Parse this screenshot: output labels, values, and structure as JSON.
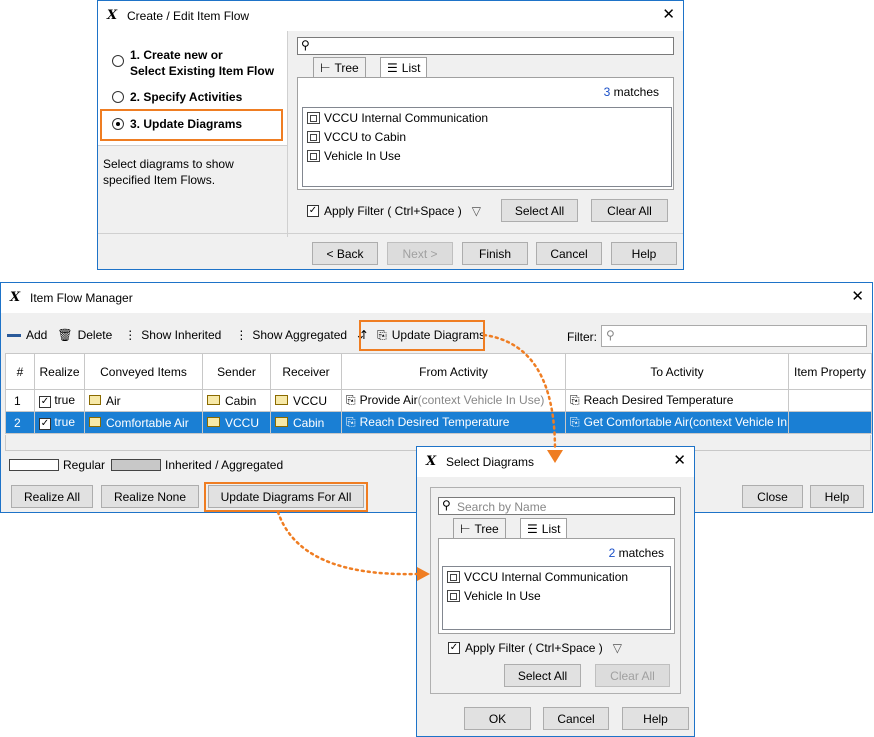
{
  "create_dialog": {
    "title": "Create / Edit Item Flow",
    "steps": [
      {
        "line1": "1. Create new or",
        "line2": "Select Existing Item Flow"
      },
      {
        "line1": "2. Specify Activities"
      },
      {
        "line1": "3. Update Diagrams"
      }
    ],
    "description_l1": "Select diagrams to show",
    "description_l2": "specified Item Flows.",
    "tabs": [
      "Tree",
      "List"
    ],
    "match_count": "3",
    "match_label": "matches",
    "items": [
      "VCCU Internal Communication",
      "VCCU to Cabin",
      "Vehicle In Use"
    ],
    "apply_filter": "Apply Filter ( Ctrl+Space )",
    "select_all": "Select All",
    "clear_all": "Clear All",
    "back": "< Back",
    "next": "Next >",
    "finish": "Finish",
    "cancel": "Cancel",
    "help": "Help"
  },
  "manager": {
    "title": "Item Flow Manager",
    "toolbar": {
      "add": "Add",
      "delete": "Delete",
      "show_inherited": "Show Inherited",
      "show_aggregated": "Show Aggregated",
      "update_diagrams": "Update Diagrams",
      "filter": "Filter:"
    },
    "columns": [
      "#",
      "Realize",
      "Conveyed Items",
      "Sender",
      "Receiver",
      "From Activity",
      "To Activity",
      "Item Property"
    ],
    "rows": [
      {
        "n": "1",
        "realize": "true",
        "item": "Air",
        "sender": "Cabin",
        "receiver": "VCCU",
        "from": "Provide Air",
        "from_ctx": "(context Vehicle In Use)",
        "to": "Reach Desired Temperature"
      },
      {
        "n": "2",
        "realize": "true",
        "item": "Comfortable Air",
        "sender": "VCCU",
        "receiver": "Cabin",
        "from": "Reach Desired Temperature",
        "from_ctx": "",
        "to": "Get Comfortable Air(context Vehicle In"
      }
    ],
    "legend_regular": "Regular",
    "legend_inherited": "Inherited / Aggregated",
    "realize_all": "Realize All",
    "realize_none": "Realize None",
    "update_all": "Update Diagrams For All",
    "close": "Close",
    "help": "Help"
  },
  "select_dialog": {
    "title": "Select Diagrams",
    "search_placeholder": "Search by Name",
    "tabs": [
      "Tree",
      "List"
    ],
    "match_count": "2",
    "match_label": "matches",
    "items": [
      "VCCU Internal Communication",
      "Vehicle In Use"
    ],
    "apply_filter": "Apply Filter ( Ctrl+Space )",
    "select_all": "Select All",
    "clear_all": "Clear All",
    "ok": "OK",
    "cancel": "Cancel",
    "help": "Help"
  },
  "colors": {
    "accent": "#ef7d22",
    "selection": "#1a7fd4",
    "titlebar": "#1170c9"
  }
}
